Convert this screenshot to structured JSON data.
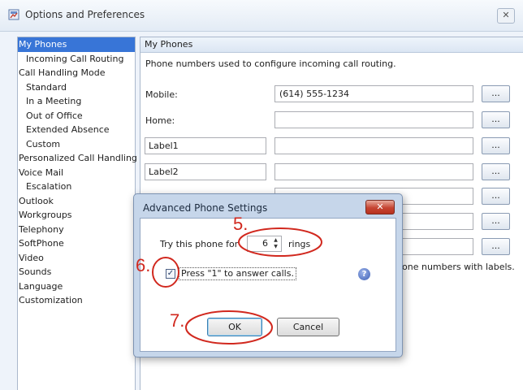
{
  "window": {
    "title": "Options and Preferences",
    "close_glyph": "✕"
  },
  "nav": {
    "items": [
      {
        "label": "My Phones",
        "level": 0,
        "selected": true
      },
      {
        "label": "Incoming Call Routing",
        "level": 1
      },
      {
        "label": "Call Handling Mode",
        "level": 0
      },
      {
        "label": "Standard",
        "level": 1
      },
      {
        "label": "In a Meeting",
        "level": 1
      },
      {
        "label": "Out of Office",
        "level": 1
      },
      {
        "label": "Extended Absence",
        "level": 1
      },
      {
        "label": "Custom",
        "level": 1
      },
      {
        "label": "Personalized Call Handling",
        "level": 0
      },
      {
        "label": "Voice Mail",
        "level": 0
      },
      {
        "label": "Escalation",
        "level": 1
      },
      {
        "label": "Outlook",
        "level": 0
      },
      {
        "label": "Workgroups",
        "level": 0
      },
      {
        "label": "Telephony",
        "level": 0
      },
      {
        "label": "SoftPhone",
        "level": 0
      },
      {
        "label": "Video",
        "level": 0
      },
      {
        "label": "Sounds",
        "level": 0
      },
      {
        "label": "Language",
        "level": 0
      },
      {
        "label": "Customization",
        "level": 0
      }
    ]
  },
  "panel": {
    "header": "My Phones",
    "description": "Phone numbers used to configure incoming call routing.",
    "rows": [
      {
        "label": "Mobile:",
        "number": "(614) 555-1234",
        "button": "..."
      },
      {
        "label": "Home:",
        "number": "",
        "button": "..."
      },
      {
        "label_field": "Label1",
        "number": "",
        "button": "..."
      },
      {
        "label_field": "Label2",
        "number": "",
        "button": "..."
      },
      {
        "number": "",
        "button": "..."
      },
      {
        "number": "",
        "button": "..."
      },
      {
        "number": "",
        "button": "..."
      }
    ],
    "tail_text": "one numbers with labels."
  },
  "dialog": {
    "title": "Advanced Phone Settings",
    "close_glyph": "✕",
    "try_label": "Try this phone for",
    "spinner_value": "6",
    "rings_label": "rings",
    "checkbox_checked": true,
    "checkbox_label": "Press \"1\" to answer calls.",
    "help_glyph": "?",
    "ok_label": "OK",
    "cancel_label": "Cancel"
  },
  "annotations": {
    "color": "#d1281e",
    "step5": "5.",
    "step6": "6.",
    "step7": "7."
  }
}
